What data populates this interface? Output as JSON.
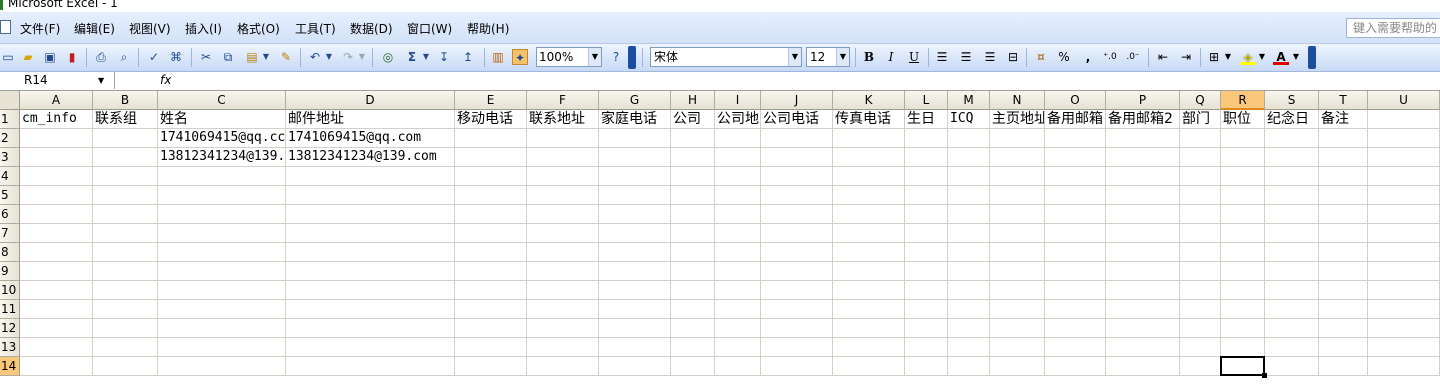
{
  "window": {
    "title": "Microsoft Excel - 1"
  },
  "menu": {
    "items": [
      "文件(F)",
      "编辑(E)",
      "视图(V)",
      "插入(I)",
      "格式(O)",
      "工具(T)",
      "数据(D)",
      "窗口(W)",
      "帮助(H)"
    ],
    "help_placeholder": "键入需要帮助的"
  },
  "toolbar": {
    "zoom": "100%",
    "font_name": "宋体",
    "font_size": "12",
    "bold": "B",
    "italic": "I",
    "underline": "U",
    "sum_symbol": "Σ",
    "percent": "%",
    "comma": ","
  },
  "formula_bar": {
    "name_box": "R14",
    "fx_label": "fx",
    "content": ""
  },
  "sheet": {
    "columns": [
      "A",
      "B",
      "C",
      "D",
      "E",
      "F",
      "G",
      "H",
      "I",
      "J",
      "K",
      "L",
      "M",
      "N",
      "O",
      "P",
      "Q",
      "R",
      "S",
      "T",
      "U"
    ],
    "rows": [
      "1",
      "2",
      "3",
      "4",
      "5",
      "6",
      "7",
      "8",
      "9",
      "10",
      "11",
      "12",
      "13",
      "14"
    ],
    "header_row": [
      "cm_info",
      "联系组",
      "姓名",
      "邮件地址",
      "移动电话",
      "联系地址",
      "家庭电话",
      "公司",
      "公司地",
      "公司电话",
      "传真电话",
      "生日",
      "ICQ",
      "主页地址",
      "备用邮箱",
      "备用邮箱2",
      "部门",
      "职位",
      "纪念日",
      "备注",
      ""
    ],
    "row2": {
      "C": "1741069415@qq.cc",
      "D": "1741069415@qq.com"
    },
    "row3": {
      "C": "13812341234@139.",
      "D": "13812341234@139.com"
    },
    "active_cell": "R14"
  }
}
